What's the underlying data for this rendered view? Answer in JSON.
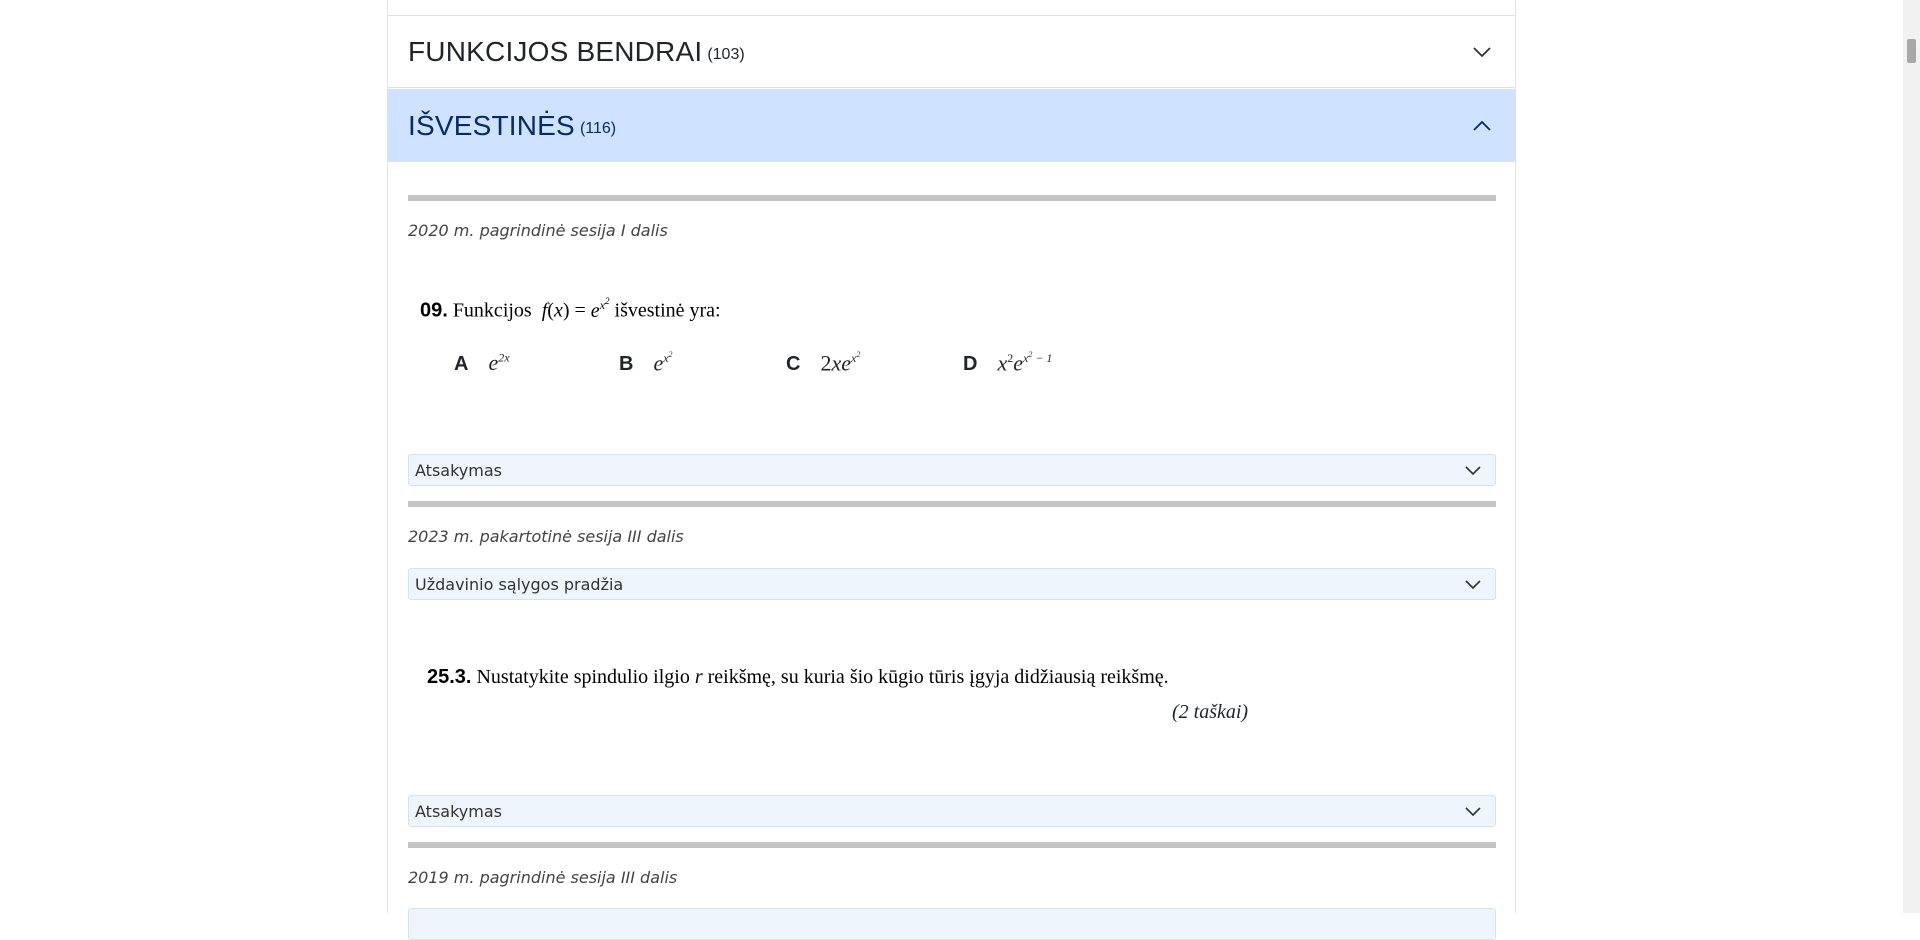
{
  "sections": [
    {
      "title": "FUNKCIJOS BENDRAI",
      "count": "(103)"
    },
    {
      "title": "IŠVESTINĖS",
      "count": "(116)"
    }
  ],
  "items": {
    "session1": "2020 m. pagrindinė sesija I dalis",
    "q1": {
      "number": "09.",
      "text_before": "Funkcijos",
      "text_after": "išvestinė yra:",
      "options": [
        {
          "label": "A"
        },
        {
          "label": "B"
        },
        {
          "label": "C"
        },
        {
          "label": "D"
        }
      ]
    },
    "answer1": "Atsakymas",
    "session2": "2023 m. pakartotinė sesija III dalis",
    "condition2": "Uždavinio sąlygos pradžia",
    "q2": {
      "number": "25.3.",
      "text": "Nustatykite spindulio ilgio",
      "var": "r",
      "text_after": "reikšmę, su kuria šio kūgio tūris įgyja didžiausią reikšmę.",
      "points": "(2 taškai)"
    },
    "answer2": "Atsakymas",
    "session3": "2019 m. pagrindinė sesija III dalis"
  },
  "colors": {
    "active_header_bg": "#cfe2ff",
    "active_header_text": "#052c65",
    "toggle_bg": "#eef5fd"
  }
}
